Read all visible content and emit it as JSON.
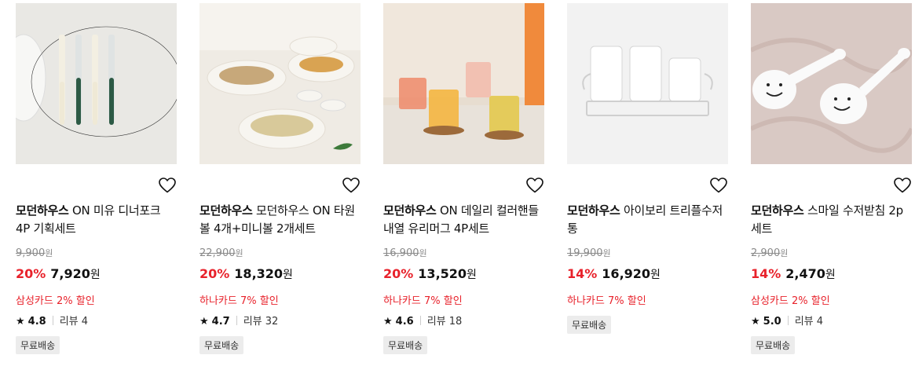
{
  "colors": {
    "discount": "#e8222b",
    "promo": "#e8222b",
    "badge_bg": "#ececec"
  },
  "products": [
    {
      "image": "fork-set-image",
      "brand": "모던하우스",
      "name": "ON 미유 디너포크 4P 기획세트",
      "original_price": "9,900",
      "original_won": "원",
      "discount_rate": "20%",
      "sale_price": "7,920",
      "sale_won": "원",
      "card_promo": "삼성카드 2% 할인",
      "rating": "4.8",
      "review_label": "리뷰 4",
      "badge": "무료배송"
    },
    {
      "image": "bowl-set-image",
      "brand": "모던하우스",
      "name": "모던하우스 ON 타원볼 4개+미니볼 2개세트",
      "original_price": "22,900",
      "original_won": "원",
      "discount_rate": "20%",
      "sale_price": "18,320",
      "sale_won": "원",
      "card_promo": "하나카드 7% 할인",
      "rating": "4.7",
      "review_label": "리뷰 32",
      "badge": "무료배송"
    },
    {
      "image": "glass-mug-image",
      "brand": "모던하우스",
      "name": "ON 데일리 컬러핸들 내열 유리머그 4P세트",
      "original_price": "16,900",
      "original_won": "원",
      "discount_rate": "20%",
      "sale_price": "13,520",
      "sale_won": "원",
      "card_promo": "하나카드 7% 할인",
      "rating": "4.6",
      "review_label": "리뷰 18",
      "badge": "무료배송"
    },
    {
      "image": "utensil-holder-image",
      "brand": "모던하우스",
      "name": "아이보리 트리플수저통",
      "original_price": "19,900",
      "original_won": "원",
      "discount_rate": "14%",
      "sale_price": "16,920",
      "sale_won": "원",
      "card_promo": "하나카드 7% 할인",
      "badge": "무료배송"
    },
    {
      "image": "spoon-rest-image",
      "brand": "모던하우스",
      "name": "스마일 수저받침 2p세트",
      "original_price": "2,900",
      "original_won": "원",
      "discount_rate": "14%",
      "sale_price": "2,470",
      "sale_won": "원",
      "card_promo": "삼성카드 2% 할인",
      "rating": "5.0",
      "review_label": "리뷰 4",
      "badge": "무료배송"
    }
  ]
}
